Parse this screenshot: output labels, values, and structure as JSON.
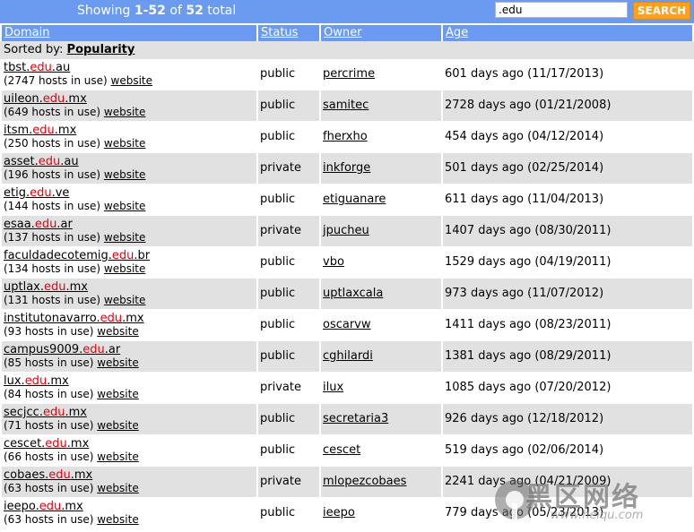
{
  "topbar": {
    "showing_prefix": "Showing ",
    "showing_range": "1-52",
    "showing_of": " of ",
    "showing_total": "52",
    "showing_suffix": " total",
    "search_value": ".edu",
    "search_button": "SEARCH"
  },
  "columns": [
    "Domain",
    "Status",
    "Owner",
    "Age"
  ],
  "sorted": {
    "label": "Sorted by: ",
    "value": "Popularity"
  },
  "colors": {
    "header_bg": "#6b9bf0",
    "button_bg": "#ffa01c",
    "edu_red": "#e8000b",
    "row_alt": "#e1e1e1"
  },
  "rows": [
    {
      "pre": "tbst.",
      "suf": ".au",
      "hosts": "(2747 hosts in use) ",
      "status": "public",
      "owner": "percrime",
      "age": "601 days ago (11/17/2013)"
    },
    {
      "pre": "uileon.",
      "suf": ".mx",
      "hosts": "(649 hosts in use) ",
      "status": "public",
      "owner": "samitec",
      "age": "2728 days ago (01/21/2008)"
    },
    {
      "pre": "itsm.",
      "suf": ".mx",
      "hosts": "(250 hosts in use) ",
      "status": "public",
      "owner": "fherxho",
      "age": "454 days ago (04/12/2014)"
    },
    {
      "pre": "asset.",
      "suf": ".au",
      "hosts": "(196 hosts in use) ",
      "status": "private",
      "owner": "inkforge",
      "age": "501 days ago (02/25/2014)"
    },
    {
      "pre": "etig.",
      "suf": ".ve",
      "hosts": "(144 hosts in use) ",
      "status": "public",
      "owner": "etiguanare",
      "age": "611 days ago (11/04/2013)"
    },
    {
      "pre": "esaa.",
      "suf": ".ar",
      "hosts": "(137 hosts in use) ",
      "status": "private",
      "owner": "jpucheu",
      "age": "1407 days ago (08/30/2011)"
    },
    {
      "pre": "faculdadecotemig.",
      "suf": ".br",
      "hosts": "(134 hosts in use) ",
      "status": "public",
      "owner": "vbo",
      "age": "1529 days ago (04/19/2011)"
    },
    {
      "pre": "uptlax.",
      "suf": ".mx",
      "hosts": "(131 hosts in use) ",
      "status": "public",
      "owner": "uptlaxcala",
      "age": "973 days ago (11/07/2012)"
    },
    {
      "pre": "institutonavarro.",
      "suf": ".mx",
      "hosts": "(93 hosts in use) ",
      "status": "public",
      "owner": "oscarvw",
      "age": "1411 days ago (08/23/2011)"
    },
    {
      "pre": "campus9009.",
      "suf": ".ar",
      "hosts": "(85 hosts in use) ",
      "status": "public",
      "owner": "cghilardi",
      "age": "1381 days ago (08/29/2011)"
    },
    {
      "pre": "lux.",
      "suf": ".mx",
      "hosts": "(84 hosts in use) ",
      "status": "private",
      "owner": "ilux",
      "age": "1085 days ago (07/20/2012)"
    },
    {
      "pre": "secjcc.",
      "suf": ".mx",
      "hosts": "(71 hosts in use) ",
      "status": "public",
      "owner": "secretaria3",
      "age": "926 days ago (12/18/2012)"
    },
    {
      "pre": "cescet.",
      "suf": ".mx",
      "hosts": "(66 hosts in use) ",
      "status": "public",
      "owner": "cescet",
      "age": "519 days ago (02/06/2014)"
    },
    {
      "pre": "cobaes.",
      "suf": ".mx",
      "hosts": "(63 hosts in use) ",
      "status": "private",
      "owner": "mlopezcobaes",
      "age": "2241 days ago (04/21/2009)"
    },
    {
      "pre": "ieepo.",
      "suf": ".mx",
      "hosts": "(63 hosts in use) ",
      "status": "public",
      "owner": "ieepo",
      "age": "779 days ago (05/23/2013)"
    }
  ],
  "edu_text": "edu",
  "website_label": "website",
  "watermark": {
    "text": "黑区网络",
    "url": "www.heiqu.com"
  }
}
